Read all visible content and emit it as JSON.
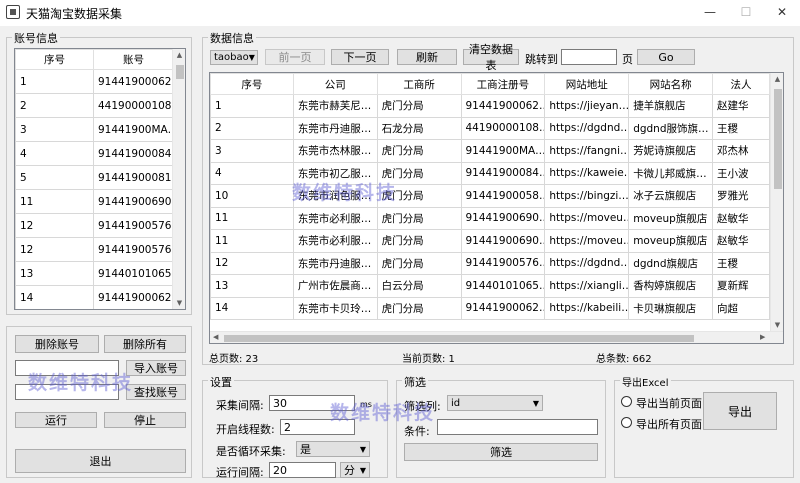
{
  "window": {
    "title": "天猫淘宝数据采集",
    "minimize": "—",
    "maximize": "☐",
    "close": "✕"
  },
  "account": {
    "group_title": "账号信息",
    "headers": [
      "序号",
      "账号"
    ],
    "rows": [
      [
        "1",
        "91441900062…"
      ],
      [
        "2",
        "44190000108…"
      ],
      [
        "3",
        "91441900MA…"
      ],
      [
        "4",
        "91441900084…"
      ],
      [
        "5",
        "91441900081…"
      ],
      [
        "11",
        "91441900690…"
      ],
      [
        "12",
        "91441900576…"
      ],
      [
        "12",
        "91441900576…"
      ],
      [
        "13",
        "91440101065…"
      ],
      [
        "14",
        "91441900062…"
      ]
    ]
  },
  "account_ops": {
    "delete_account": "删除账号",
    "delete_all": "删除所有",
    "import_account": "导入账号",
    "find_account": "查找账号",
    "run": "运行",
    "stop": "停止",
    "exit": "退出"
  },
  "data": {
    "group_title": "数据信息",
    "source_select": "taobao",
    "prev_page": "前一页",
    "next_page": "下一页",
    "refresh": "刷新",
    "clear_table": "清空数据表",
    "goto_label": "跳转到",
    "page_unit": "页",
    "go": "Go",
    "headers": [
      "序号",
      "公司",
      "工商所",
      "工商注册号",
      "网站地址",
      "网站名称",
      "法人"
    ],
    "rows": [
      [
        "1",
        "东莞市赫芙尼…",
        "虎门分局",
        "91441900062…",
        "https://jieyan…",
        "捷羊旗舰店",
        "赵建华"
      ],
      [
        "2",
        "东莞市丹迪服…",
        "石龙分局",
        "44190000108…",
        "https://dgdnd…",
        "dgdnd服饰旗…",
        "王稷"
      ],
      [
        "3",
        "东莞市杰林服…",
        "虎门分局",
        "91441900MA…",
        "https://fangni…",
        "芳妮诗旗舰店",
        "邓杰林"
      ],
      [
        "4",
        "东莞市初乙服…",
        "虎门分局",
        "91441900084…",
        "https://kaweie…",
        "卡微儿邦威旗…",
        "王小波"
      ],
      [
        "10",
        "东莞市润色服…",
        "虎门分局",
        "91441900058…",
        "https://bingzi…",
        "冰子云旗舰店",
        "罗雅光"
      ],
      [
        "11",
        "东莞市必利服…",
        "虎门分局",
        "91441900690…",
        "https://moveu…",
        "moveup旗舰店",
        "赵敏华"
      ],
      [
        "11",
        "东莞市必利服…",
        "虎门分局",
        "91441900690…",
        "https://moveu…",
        "moveup旗舰店",
        "赵敏华"
      ],
      [
        "12",
        "东莞市丹迪服…",
        "虎门分局",
        "91441900576…",
        "https://dgdnd…",
        "dgdnd旗舰店",
        "王稷"
      ],
      [
        "13",
        "广州市佐晨商…",
        "白云分局",
        "91440101065…",
        "https://xiangli…",
        "香构婷旗舰店",
        "夏新辉"
      ],
      [
        "14",
        "东莞市卡贝玲…",
        "虎门分局",
        "91441900062…",
        "https://kabeili…",
        "卡贝琳旗舰店",
        "向超"
      ]
    ]
  },
  "status": {
    "total_pages": "总页数: 23",
    "current_page": "当前页数: 1",
    "total_records": "总条数: 662"
  },
  "settings": {
    "group_title": "设置",
    "interval_label": "采集间隔:",
    "interval_value": "30",
    "interval_unit": "ms",
    "threads_label": "开启线程数:",
    "threads_value": "2",
    "loop_label": "是否循环采集:",
    "loop_value": "是",
    "runtime_label": "运行间隔:",
    "runtime_value": "20",
    "runtime_unit": "分"
  },
  "filter": {
    "group_title": "筛选",
    "column_label": "筛选列:",
    "column_value": "id",
    "condition_label": "条件:",
    "condition_value": "",
    "button": "筛选"
  },
  "export": {
    "group_title": "导出Excel",
    "current_page": "导出当前页面",
    "all_pages": "导出所有页面",
    "button": "导出"
  },
  "watermarks": [
    "数维特科技",
    "数维特科技",
    "数维特科技"
  ]
}
